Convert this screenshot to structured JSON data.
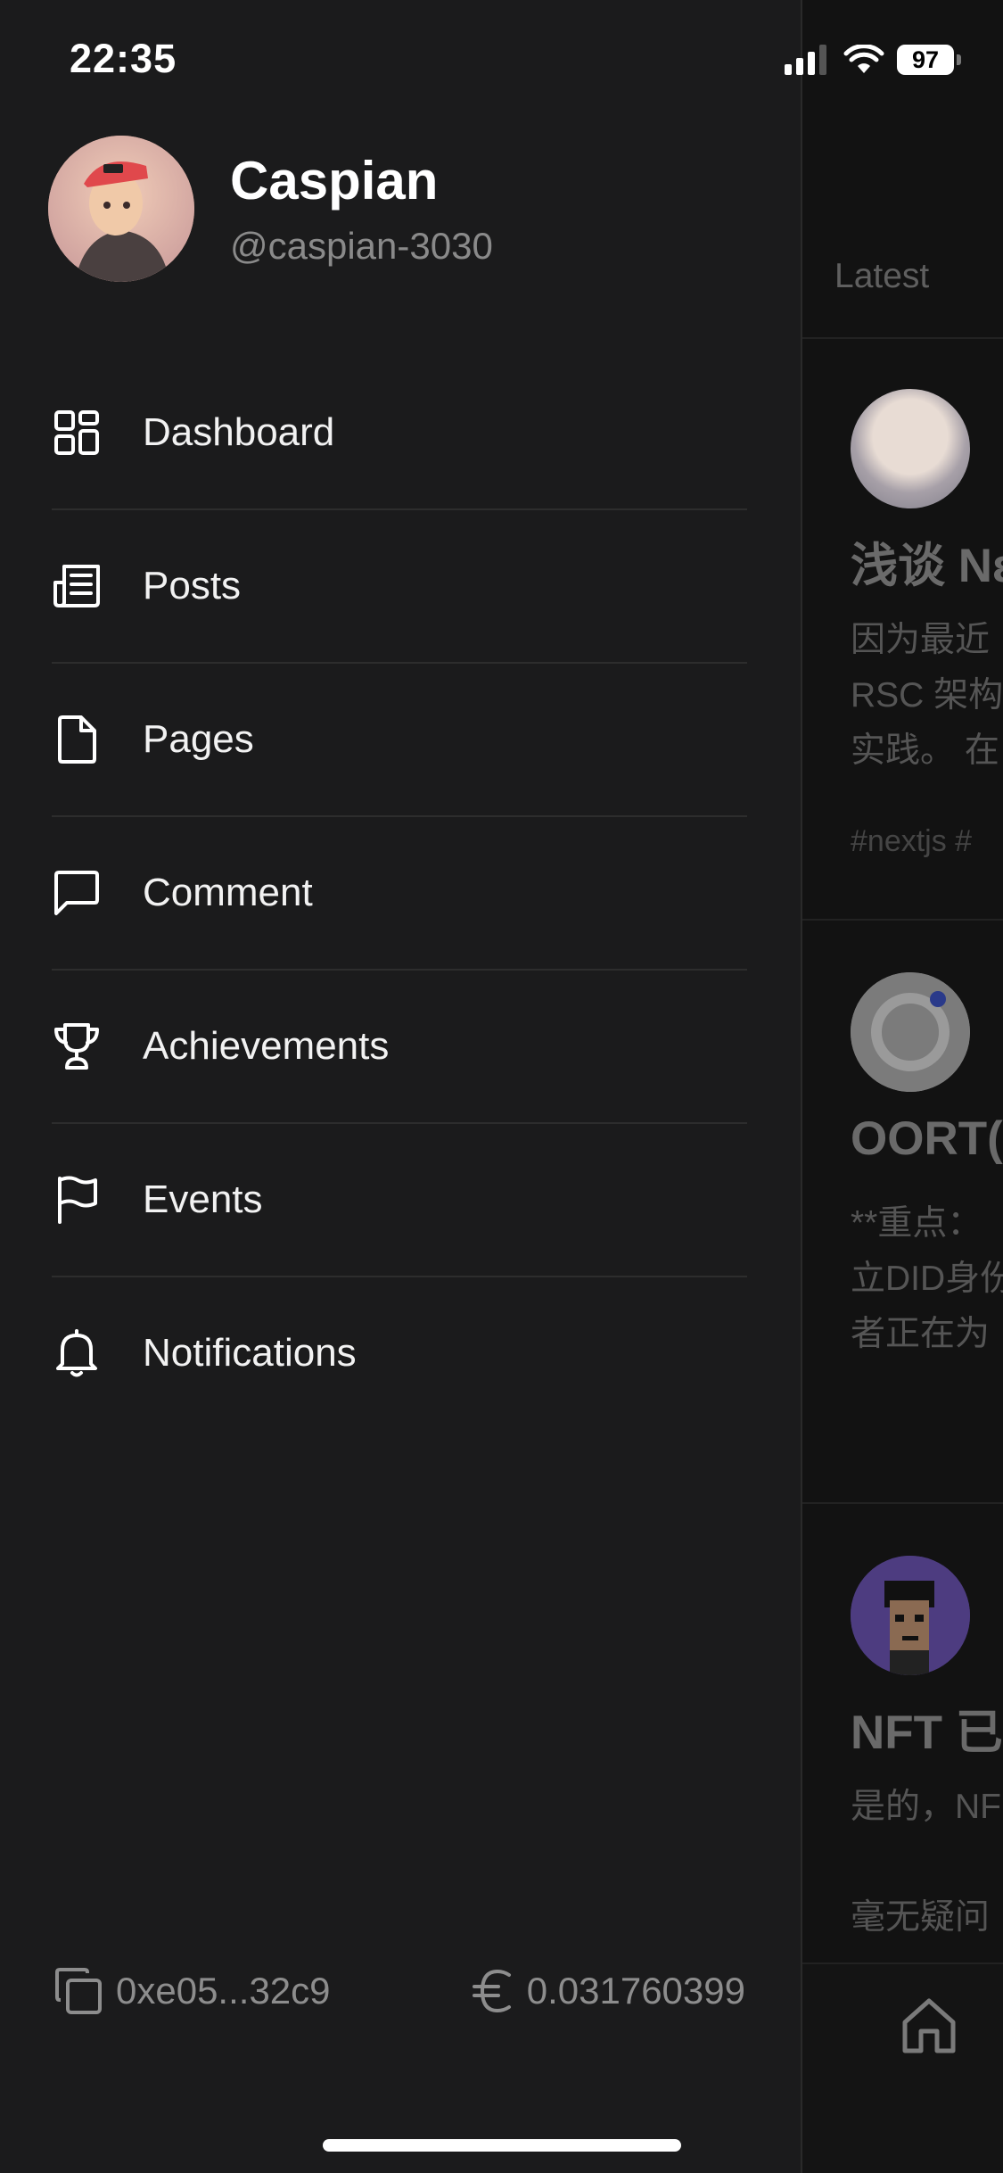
{
  "status_bar": {
    "time": "22:35",
    "battery": "97"
  },
  "profile": {
    "name": "Caspian",
    "handle": "@caspian-3030"
  },
  "menu": [
    {
      "label": "Dashboard",
      "icon": "dashboard-icon"
    },
    {
      "label": "Posts",
      "icon": "posts-icon"
    },
    {
      "label": "Pages",
      "icon": "page-icon"
    },
    {
      "label": "Comment",
      "icon": "comment-icon"
    },
    {
      "label": "Achievements",
      "icon": "trophy-icon"
    },
    {
      "label": "Events",
      "icon": "flag-icon"
    },
    {
      "label": "Notifications",
      "icon": "bell-icon"
    }
  ],
  "footer": {
    "address": "0xe05...32c9",
    "balance": "0.031760399"
  },
  "background_feed": {
    "tab_latest": "Latest",
    "posts": [
      {
        "title": "浅谈 Nε",
        "lines": [
          "因为最近",
          "RSC 架构",
          "实践。 在"
        ],
        "tags": "#nextjs  #"
      },
      {
        "title": "OORT(",
        "lines": [
          "**重点：",
          "立DID身份",
          "者正在为"
        ]
      },
      {
        "title": "NFT 已",
        "lines": [
          "是的，NF",
          "",
          "毫无疑问"
        ]
      }
    ]
  }
}
